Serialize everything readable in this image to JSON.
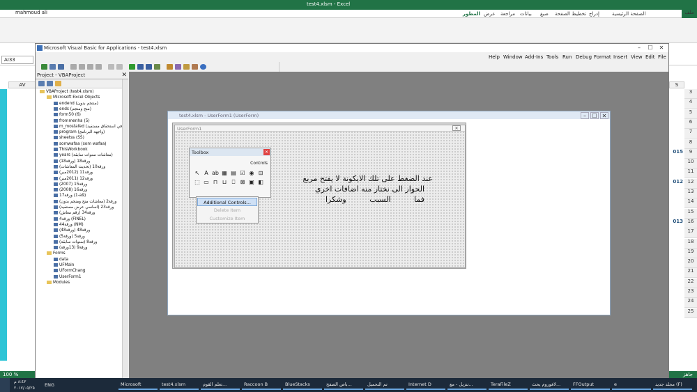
{
  "excel": {
    "title": "test4.xlsm - Excel",
    "user": "mahmoud ali",
    "file_tab": "ملف",
    "tabs": [
      "الصفحة الرئيسية",
      "إدراج",
      "تخطيط الصفحة",
      "صيغ",
      "بيانات",
      "مراجعة",
      "عرض",
      "المطور"
    ],
    "name_box": "AI33",
    "col_left": "AV",
    "col_right": "S",
    "rows": [
      {
        "n": "3",
        "v": ""
      },
      {
        "n": "4",
        "v": ""
      },
      {
        "n": "5",
        "v": ""
      },
      {
        "n": "6",
        "v": ""
      },
      {
        "n": "7",
        "v": ""
      },
      {
        "n": "8",
        "v": ""
      },
      {
        "n": "9",
        "v": "015"
      },
      {
        "n": "10",
        "v": ""
      },
      {
        "n": "11",
        "v": ""
      },
      {
        "n": "12",
        "v": "012"
      },
      {
        "n": "13",
        "v": ""
      },
      {
        "n": "14",
        "v": ""
      },
      {
        "n": "15",
        "v": ""
      },
      {
        "n": "16",
        "v": "013"
      },
      {
        "n": "17",
        "v": ""
      },
      {
        "n": "18",
        "v": ""
      },
      {
        "n": "19",
        "v": ""
      },
      {
        "n": "20",
        "v": ""
      },
      {
        "n": "21",
        "v": ""
      },
      {
        "n": "22",
        "v": ""
      },
      {
        "n": "23",
        "v": ""
      },
      {
        "n": "24",
        "v": ""
      },
      {
        "n": "25",
        "v": ""
      }
    ],
    "zoom": "100 %",
    "status_right": "جاهز"
  },
  "vba": {
    "title": "Microsoft Visual Basic for Applications - test4.xlsm",
    "menu": [
      "File",
      "Edit",
      "View",
      "Insert",
      "Format",
      "Debug",
      "Run",
      "Tools",
      "Add-Ins",
      "Window",
      "Help"
    ],
    "project_title": "Project - VBAProject",
    "tree": [
      {
        "indent": 0,
        "kind": "fd",
        "label": "VBAProject (test4.xlsm)"
      },
      {
        "indent": 1,
        "kind": "fd",
        "label": "Microsoft Excel Objects"
      },
      {
        "indent": 2,
        "kind": "ic",
        "label": "endend (منتجم بدون)"
      },
      {
        "indent": 2,
        "kind": "ic",
        "label": "ends (منح ومنجم)"
      },
      {
        "indent": 2,
        "kind": "ic",
        "label": "form50 (6)"
      },
      {
        "indent": 2,
        "kind": "ic",
        "label": "frommenha (5)"
      },
      {
        "indent": 2,
        "kind": "ic",
        "label": "m_mostafed (في استحقاق مستفيد)"
      },
      {
        "indent": 2,
        "kind": "ic",
        "label": "program (واجهة البرنامج)"
      },
      {
        "indent": 2,
        "kind": "ic",
        "label": "sheetss (SS)"
      },
      {
        "indent": 2,
        "kind": "ic",
        "label": "somwafaa (som wafaa)"
      },
      {
        "indent": 2,
        "kind": "ic",
        "label": "ThisWorkbook"
      },
      {
        "indent": 2,
        "kind": "ic",
        "label": "years (معاشات سنوات سابقة)"
      },
      {
        "indent": 2,
        "kind": "ic",
        "label": "ورقة18 (ورقة18)"
      },
      {
        "indent": 2,
        "kind": "ic",
        "label": "ورقة10 (تحديث المعاشات)"
      },
      {
        "indent": 2,
        "kind": "ic",
        "label": "ورقة11 (2012مبر)"
      },
      {
        "indent": 2,
        "kind": "ic",
        "label": "ورقة12 (2011مبر)"
      },
      {
        "indent": 2,
        "kind": "ic",
        "label": "ورقة15 (2007)"
      },
      {
        "indent": 2,
        "kind": "ic",
        "label": "ورقة16 (2008)"
      },
      {
        "indent": 2,
        "kind": "ic",
        "label": "ورقة17 (1-a9)"
      },
      {
        "indent": 2,
        "kind": "ic",
        "label": "ورقة2 (معاشات منح ومنجم بدون)"
      },
      {
        "indent": 2,
        "kind": "ic",
        "label": "ورقة23 (اساسي عرض مستفيد)"
      },
      {
        "indent": 2,
        "kind": "ic",
        "label": "ورقة34 (رقم معاش)"
      },
      {
        "indent": 2,
        "kind": "ic",
        "label": "ورقة4 (FINEL)"
      },
      {
        "indent": 2,
        "kind": "ic",
        "label": "ورقة44 (NM)"
      },
      {
        "indent": 2,
        "kind": "ic",
        "label": "ورقة48 (ورقة48)"
      },
      {
        "indent": 2,
        "kind": "ic",
        "label": "ورقة5 (ورقة5)"
      },
      {
        "indent": 2,
        "kind": "ic",
        "label": "ورقة8 (سنوات سابقة)"
      },
      {
        "indent": 2,
        "kind": "ic",
        "label": "ورقة9 (13ورقة)"
      },
      {
        "indent": 1,
        "kind": "fd",
        "label": "Forms"
      },
      {
        "indent": 2,
        "kind": "ic",
        "label": "data"
      },
      {
        "indent": 2,
        "kind": "ic",
        "label": "UFMain"
      },
      {
        "indent": 2,
        "kind": "ic",
        "label": "UFormChang"
      },
      {
        "indent": 2,
        "kind": "ic",
        "label": "UserForm1"
      },
      {
        "indent": 1,
        "kind": "fd",
        "label": "Modules"
      }
    ],
    "uf_window_title": "test4.xlsm - UserForm1 (UserForm)",
    "form_caption": "UserForm1",
    "arabic_line1": "عند الضغط على تلك الايكونة لا يفتح مربع",
    "arabic_line2": "الحوار الى نختار منه اضافات اخري",
    "arabic_line3": "فما السبب وشكرا",
    "toolbox_title": "Toolbox",
    "toolbox_tab": "Controls",
    "toolbox_tools": [
      "↖",
      "A",
      "ab",
      "▦",
      "▤",
      "☑",
      "◉",
      "⊟",
      "⬚",
      "▭",
      "⊓",
      "⊔",
      "⎕",
      "⊠",
      "▣",
      "◧"
    ],
    "context_menu": [
      "Additional Controls...",
      "Delete Item",
      "Customize Item"
    ]
  },
  "taskbar": [
    "Microsoft",
    "test4.xlsm",
    "تعلم القوم...",
    "Raccoon B",
    "BlueStacks",
    "باص الصفح...",
    "تم التحميل",
    "Internet D",
    "تنزيل - مع...",
    "TeraFileZ",
    "لافوروم يحث...",
    "FFOutput",
    "e",
    "مجلد جديد (F)"
  ],
  "clock": "٨:٤٣ م",
  "date": "٢٠١٧/٠٥/٢٥",
  "lang": "ENG"
}
